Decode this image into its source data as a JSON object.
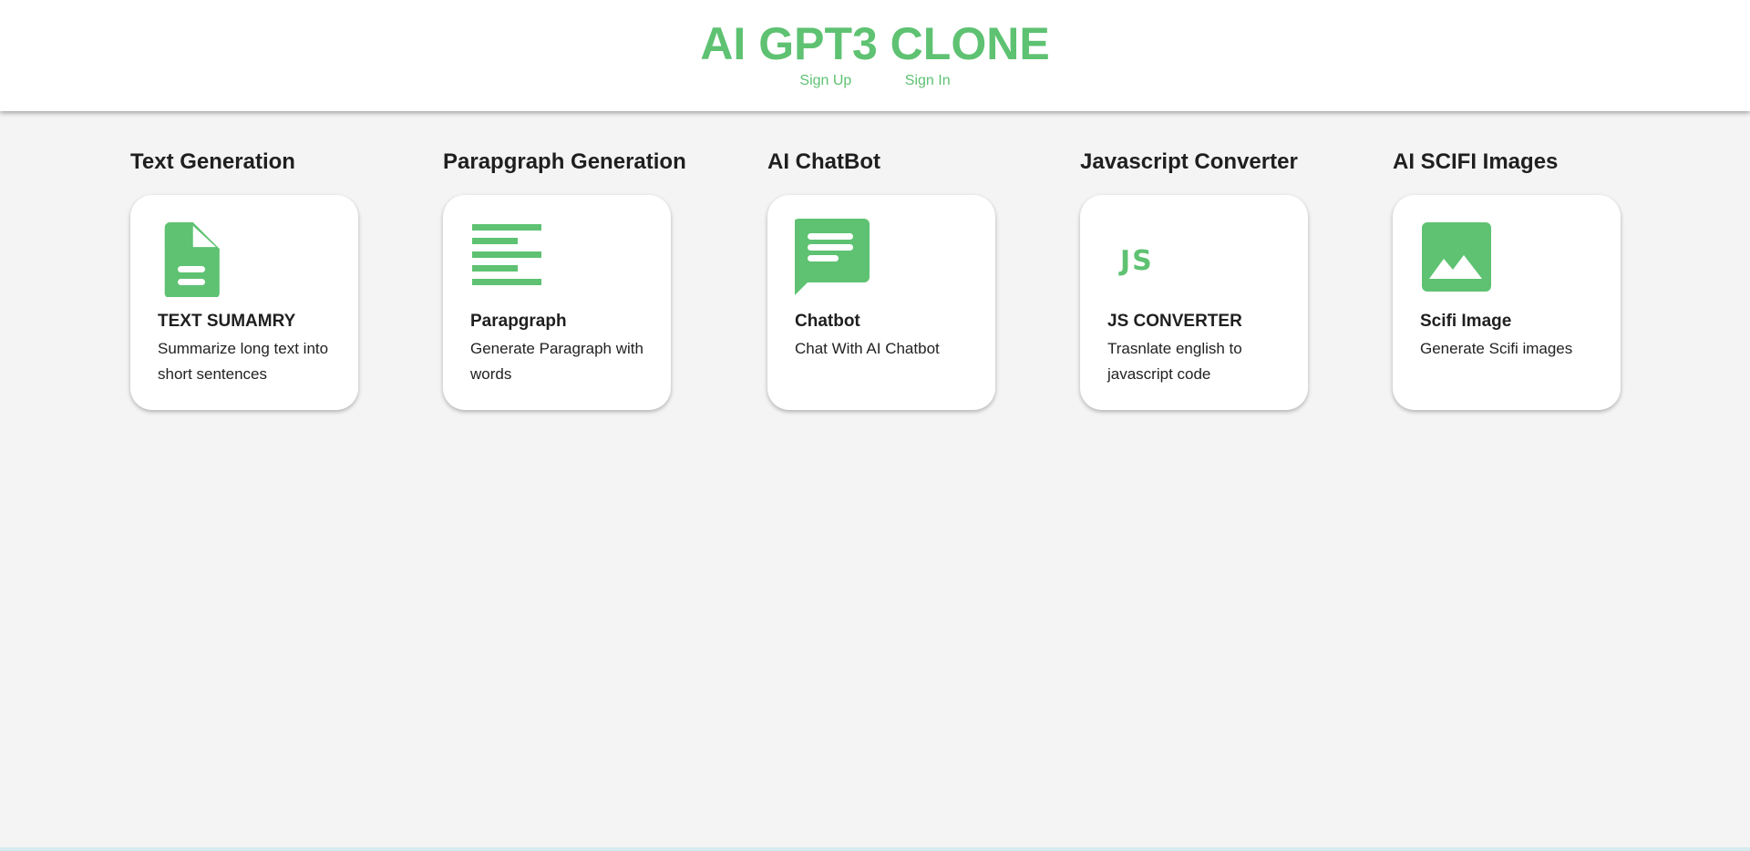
{
  "header": {
    "title": "AI GPT3 CLONE",
    "nav": {
      "sign_up": "Sign Up",
      "sign_in": "Sign In"
    }
  },
  "accent_color": "#5ec272",
  "sections": [
    {
      "heading": "Text Generation",
      "card": {
        "icon": "document-icon",
        "title": "TEXT SUMAMRY",
        "description": "Summarize long text into short sentences"
      }
    },
    {
      "heading": "Parapgraph Generation",
      "card": {
        "icon": "paragraph-icon",
        "title": "Parapgraph",
        "description": "Generate Paragraph with words"
      }
    },
    {
      "heading": "AI ChatBot",
      "card": {
        "icon": "chat-icon",
        "title": "Chatbot",
        "description": "Chat With AI Chatbot"
      }
    },
    {
      "heading": "Javascript Converter",
      "card": {
        "icon": "javascript-icon",
        "icon_text": "JS",
        "title": "JS CONVERTER",
        "description": "Trasnlate english to javascript code"
      }
    },
    {
      "heading": "AI SCIFI Images",
      "card": {
        "icon": "image-icon",
        "title": "Scifi Image",
        "description": "Generate Scifi images"
      }
    }
  ]
}
